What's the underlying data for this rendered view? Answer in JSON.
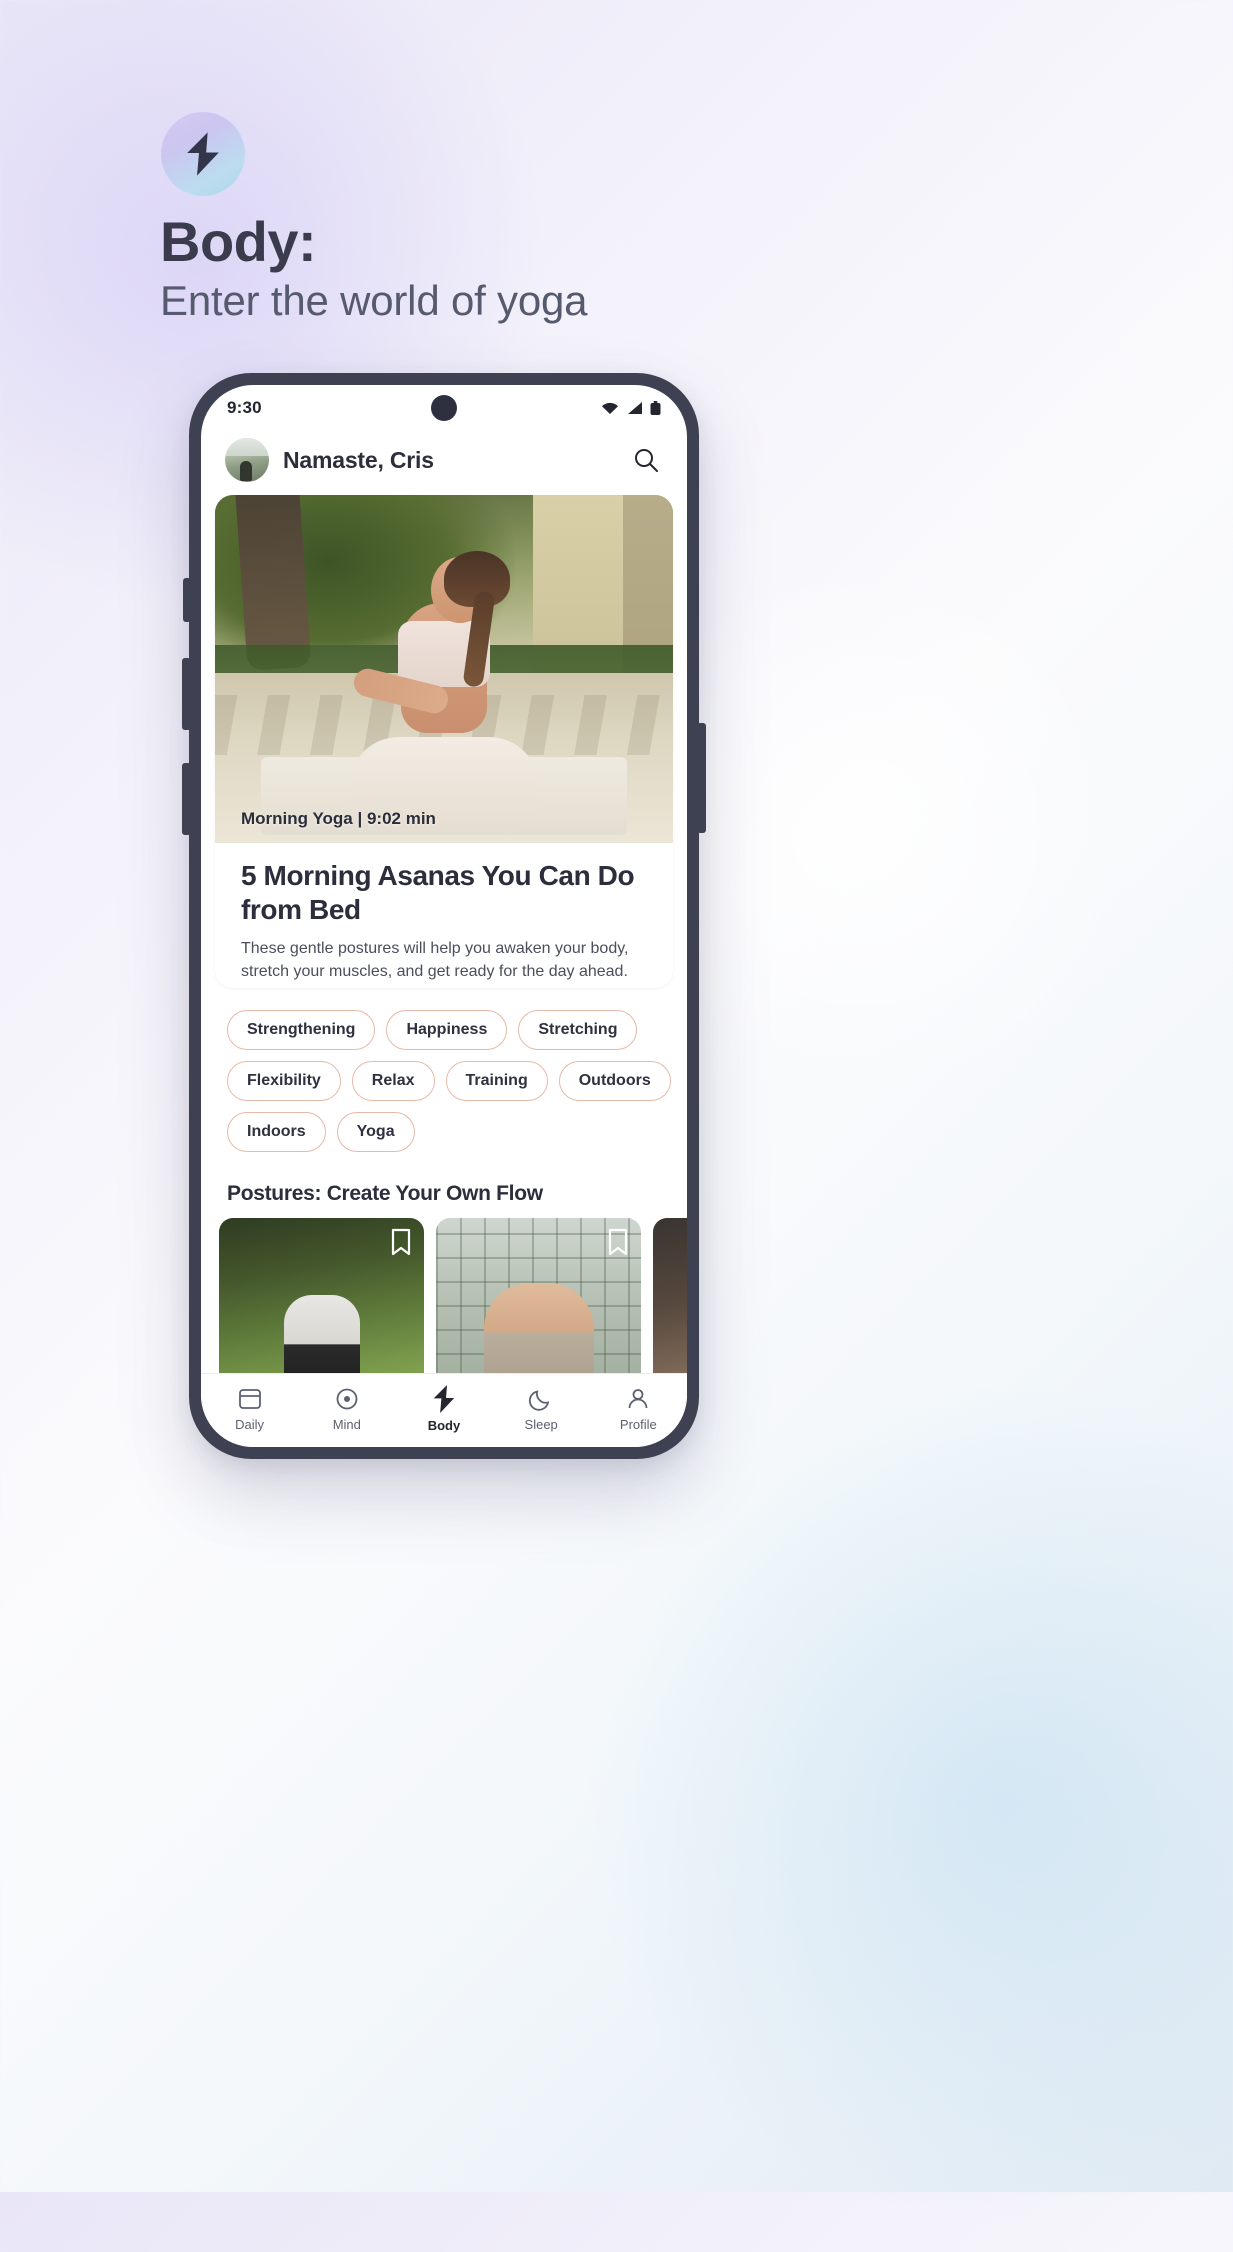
{
  "promo": {
    "logo_icon": "lightning-bolt-icon",
    "title": "Body:",
    "subtitle": "Enter the world of yoga",
    "colors": {
      "title": "#3a3c4e",
      "subtitle": "#565a6e",
      "badge_gradient_from": "#d8c9f2",
      "badge_gradient_to": "#aed8ea",
      "background_from": "#e9e6f7",
      "background_to": "#dfeaf3"
    }
  },
  "phone": {
    "statusbar": {
      "time": "9:30",
      "icons": [
        "wifi-icon",
        "cellular-signal-icon",
        "battery-icon"
      ]
    },
    "header": {
      "greeting": "Namaste, Cris",
      "avatar_name": "user-avatar",
      "search_icon": "search-icon"
    },
    "hero": {
      "meta": "Morning Yoga | 9:02 min",
      "title": "5 Morning Asanas You Can Do from Bed",
      "description": "These gentle postures will help you awaken your body, stretch your muscles, and get ready for the day ahead."
    },
    "chips": [
      "Strengthening",
      "Happiness",
      "Stretching",
      "Flexibility",
      "Relax",
      "Training",
      "Outdoors",
      "Indoors",
      "Yoga"
    ],
    "chip_border_color": "#e6b9a8",
    "section": {
      "title": "Postures: Create Your Own Flow",
      "cards": [
        {
          "name": "posture-card-meditation",
          "bookmark_icon": "bookmark-icon"
        },
        {
          "name": "posture-card-temples",
          "bookmark_icon": "bookmark-icon"
        },
        {
          "name": "posture-card-indoor",
          "bookmark_icon": "bookmark-icon"
        }
      ]
    },
    "bottomnav": {
      "active": "Body",
      "items": [
        {
          "label": "Daily",
          "icon": "calendar-icon"
        },
        {
          "label": "Mind",
          "icon": "circle-dot-icon"
        },
        {
          "label": "Body",
          "icon": "lightning-bolt-icon"
        },
        {
          "label": "Sleep",
          "icon": "moon-icon"
        },
        {
          "label": "Profile",
          "icon": "person-icon"
        }
      ]
    }
  }
}
